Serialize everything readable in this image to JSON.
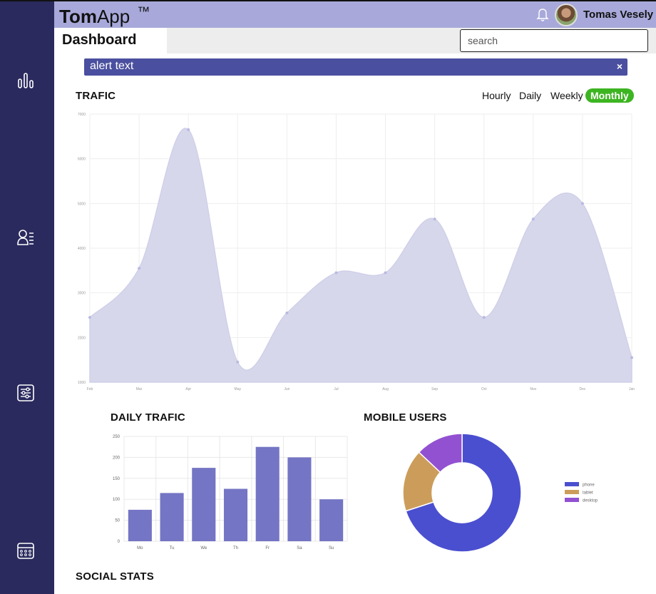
{
  "app": {
    "brand_bold": "Tom",
    "brand_rest": "App",
    "trademark": "™"
  },
  "header": {
    "user_name": "Tomas Vesely"
  },
  "nav": {
    "active_tab": "Dashboard"
  },
  "search": {
    "placeholder": "search",
    "value": ""
  },
  "alert": {
    "text": "alert text",
    "close": "×"
  },
  "traffic": {
    "title": "TRAFIC",
    "ranges": [
      "Hourly",
      "Daily",
      "Weekly",
      "Monthly"
    ],
    "active_range": "Monthly"
  },
  "daily": {
    "title": "DAILY TRAFIC"
  },
  "mobile": {
    "title": "MOBILE USERS"
  },
  "social": {
    "title": "SOCIAL STATS"
  },
  "colors": {
    "sidebar": "#2a2a5e",
    "header": "#a8a9da",
    "accent": "#4a4f9f",
    "active_range": "#3cb521",
    "area_fill": "#d7d7ec",
    "bar": "#7475c4",
    "phone": "#4a4fd0",
    "tablet": "#cc9d5a",
    "desktop": "#9251d1"
  },
  "icons": [
    "bar-chart-icon",
    "user-list-icon",
    "settings-sliders-icon",
    "calendar-icon",
    "bell-icon",
    "close-icon"
  ],
  "chart_data": [
    {
      "type": "area",
      "categories": [
        "Feb",
        "Mar",
        "Apr",
        "May",
        "Jun",
        "Jul",
        "Aug",
        "Sep",
        "Oct",
        "Nov",
        "Dec",
        "Jan"
      ],
      "values": [
        2450,
        3550,
        6650,
        1450,
        2550,
        3450,
        3450,
        4650,
        2450,
        4650,
        5000,
        1550
      ],
      "ylim": [
        1000,
        7000
      ],
      "yticks": [
        1000,
        2000,
        3000,
        4000,
        5000,
        6000,
        7000
      ],
      "grid": true
    },
    {
      "type": "bar",
      "categories": [
        "Mo",
        "Tu",
        "We",
        "Th",
        "Fr",
        "Sa",
        "Su"
      ],
      "values": [
        75,
        115,
        175,
        125,
        225,
        200,
        100
      ],
      "ylim": [
        0,
        250
      ],
      "yticks": [
        0,
        50,
        100,
        150,
        200,
        250
      ],
      "grid": true
    },
    {
      "type": "pie",
      "labels": [
        "phone",
        "tablet",
        "desktop"
      ],
      "values": [
        70,
        17,
        13
      ],
      "legend": "right"
    }
  ]
}
